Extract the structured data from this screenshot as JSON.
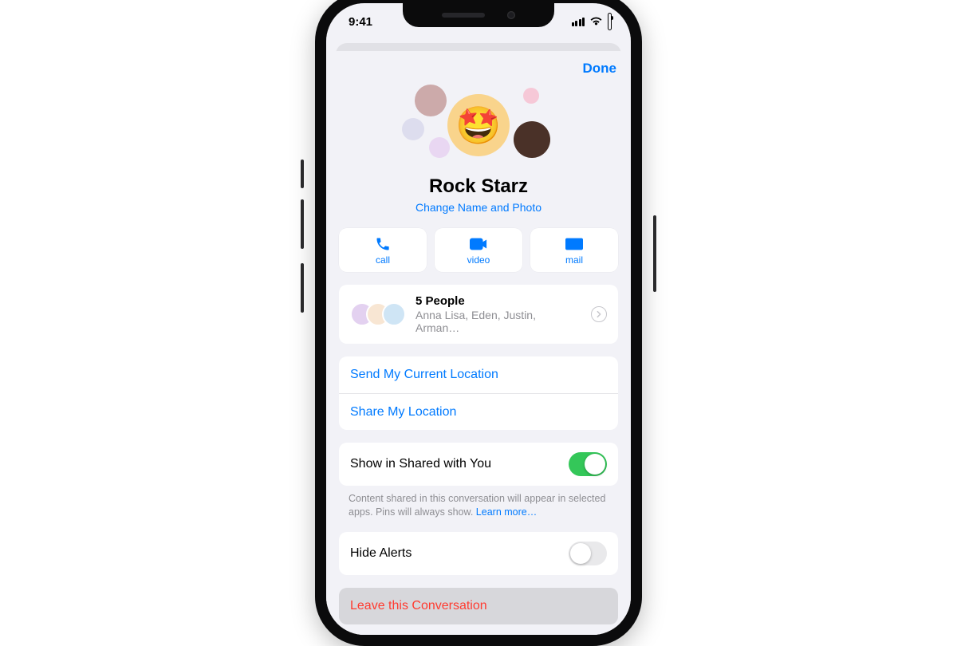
{
  "statusbar": {
    "time": "9:41"
  },
  "sheet": {
    "done_label": "Done",
    "title": "Rock Starz",
    "change_label": "Change Name and Photo"
  },
  "actions": {
    "call": "call",
    "video": "video",
    "mail": "mail"
  },
  "people": {
    "count_label": "5 People",
    "names": "Anna Lisa, Eden, Justin, Arman…"
  },
  "location": {
    "send": "Send My Current Location",
    "share": "Share My Location"
  },
  "shared": {
    "label": "Show in Shared with You",
    "note": "Content shared in this conversation will appear in selected apps. Pins will always show. ",
    "learn_more": "Learn more…"
  },
  "alerts": {
    "label": "Hide Alerts"
  },
  "leave": {
    "label": "Leave this Conversation"
  },
  "colors": {
    "accent": "#007aff",
    "danger": "#ff3b30",
    "toggle_on": "#34c759"
  }
}
